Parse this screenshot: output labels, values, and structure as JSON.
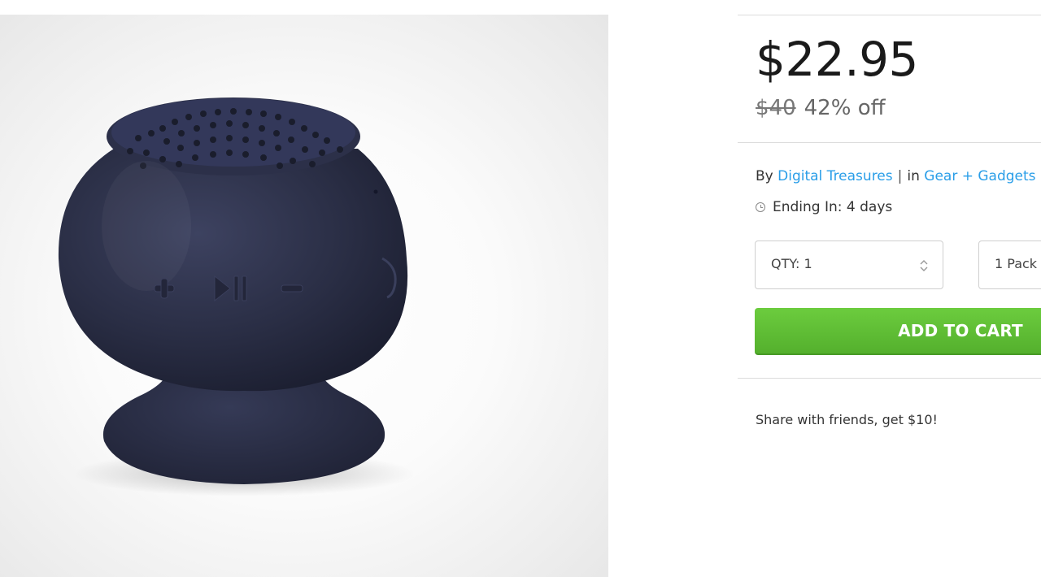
{
  "product": {
    "image_alt": "speaker-product-image"
  },
  "pricing": {
    "price": "$22.95",
    "original_price": "$40",
    "discount": "42% off"
  },
  "meta": {
    "by_label": "By",
    "vendor": "Digital Treasures",
    "separator": "|",
    "in_label": "in",
    "category": "Gear + Gadgets"
  },
  "ending": {
    "text": "Ending In: 4 days"
  },
  "purchase": {
    "qty_label": "QTY: 1",
    "pack_label": "1 Pack",
    "add_to_cart_label": "ADD TO CART"
  },
  "share": {
    "text": "Share with friends, get $10!"
  },
  "colors": {
    "link": "#2a9ee8",
    "cart_button": "#5cbf32",
    "speaker_body": "#2b2f45"
  }
}
